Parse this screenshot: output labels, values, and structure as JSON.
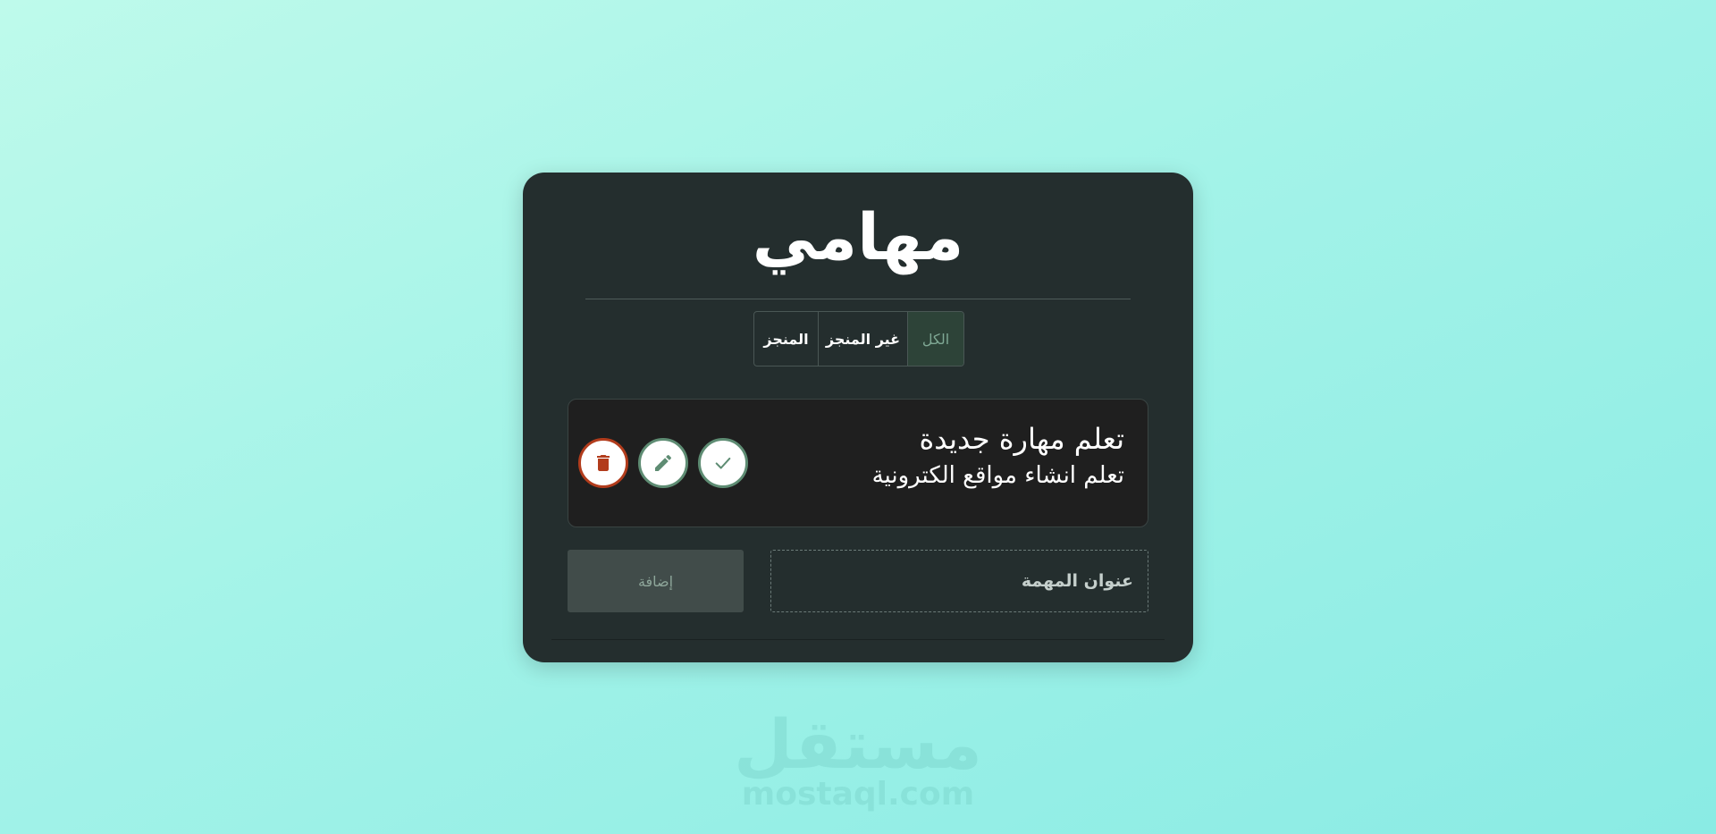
{
  "app": {
    "title": "مهامي"
  },
  "filters": {
    "all_label": "الكل",
    "not_done_label": "غير المنجز",
    "done_label": "المنجز",
    "active": "الكل"
  },
  "task": {
    "title": "تعلم مهارة جديدة",
    "details": "تعلم انشاء مواقع الكترونية"
  },
  "form": {
    "title_placeholder": "عنوان المهمة",
    "add_label": "إضافة"
  },
  "icons": {
    "done": "check-icon",
    "edit": "pencil-icon",
    "delete": "trash-icon"
  },
  "colors": {
    "card_background": "#242e2e",
    "accent_green": "#5e8c73",
    "delete_red": "#b23c1c"
  },
  "watermark": {
    "arabic": "مستقل",
    "url": "mostaql.com"
  }
}
